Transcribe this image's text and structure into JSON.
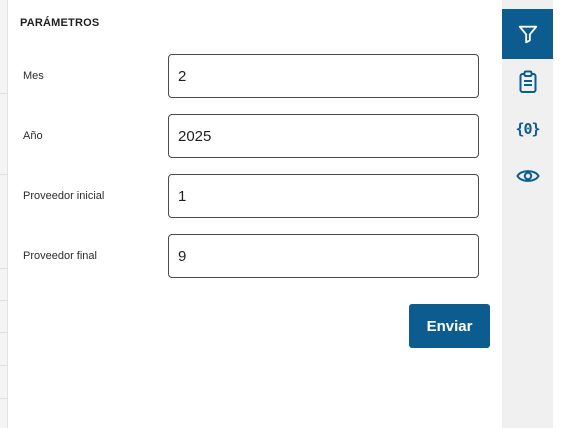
{
  "panel": {
    "title": "PARÁMETROS"
  },
  "fields": [
    {
      "label": "Mes",
      "value": "2"
    },
    {
      "label": "Año",
      "value": "2025"
    },
    {
      "label": "Proveedor inicial",
      "value": "1"
    },
    {
      "label": "Proveedor final",
      "value": "9"
    }
  ],
  "actions": {
    "submit_label": "Enviar"
  },
  "sidebar": {
    "items": [
      {
        "icon": "filter-icon",
        "active": true
      },
      {
        "icon": "clipboard-icon",
        "active": false
      },
      {
        "icon": "variables-icon",
        "glyph": "{0}",
        "active": false
      },
      {
        "icon": "eye-icon",
        "active": false
      }
    ]
  },
  "colors": {
    "accent": "#0d5c8f",
    "rail_background": "#f0f0f0",
    "input_border": "#4a4a4a"
  }
}
